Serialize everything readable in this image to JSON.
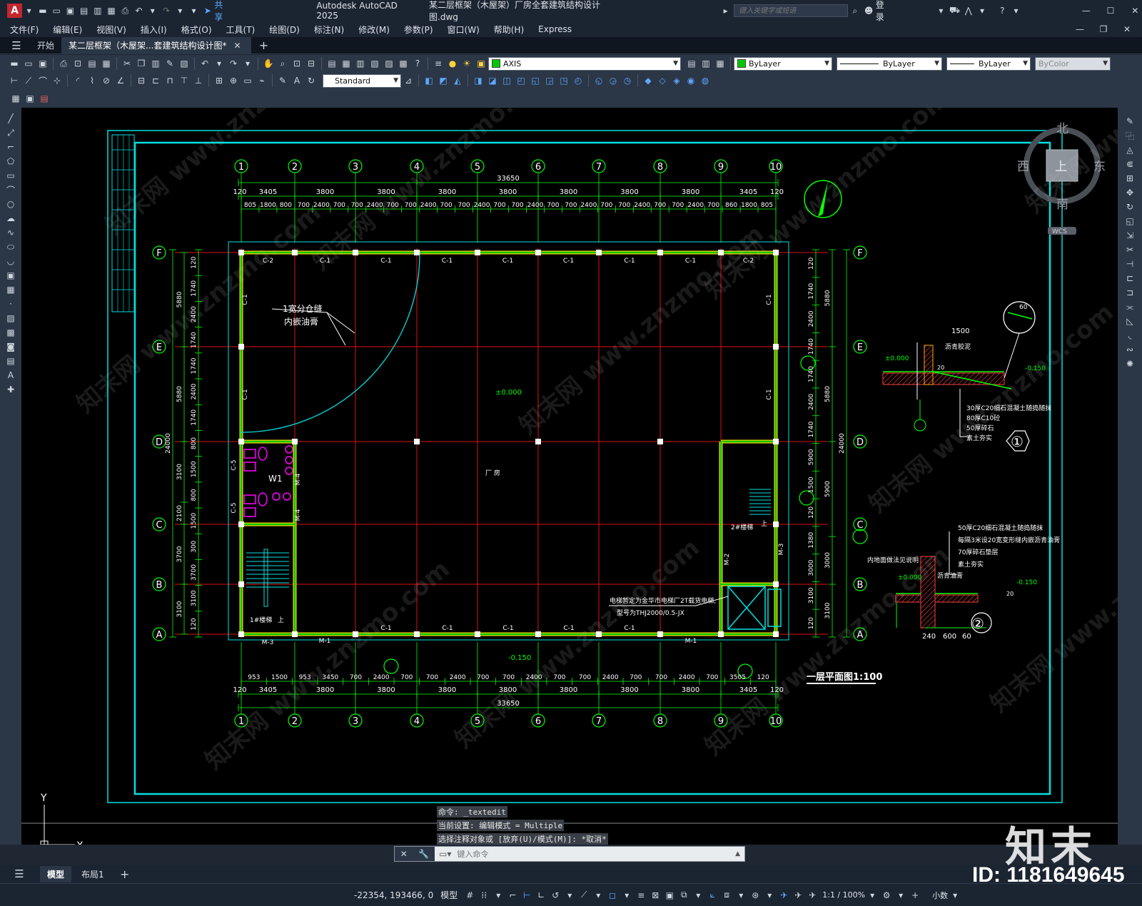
{
  "titlebar": {
    "app_title": "Autodesk AutoCAD 2025",
    "file_title": "某二层框架（木屋架）厂房全套建筑结构设计图.dwg",
    "share_label": "共享",
    "search_placeholder": "键入关键字或短语",
    "login_label": "登录"
  },
  "menu": [
    "文件(F)",
    "编辑(E)",
    "视图(V)",
    "插入(I)",
    "格式(O)",
    "工具(T)",
    "绘图(D)",
    "标注(N)",
    "修改(M)",
    "参数(P)",
    "窗口(W)",
    "帮助(H)",
    "Express"
  ],
  "tabs": {
    "start": "开始",
    "drawing": "某二层框架（木屋架...套建筑结构设计图*"
  },
  "toolbar": {
    "layer_value": "AXIS",
    "layer_color": "#00c800",
    "color_value": "ByLayer",
    "linetype_value": "ByLayer",
    "lineweight_value": "ByLayer",
    "plotstyle_value": "ByColor",
    "textstyle_value": "Standard"
  },
  "viewcube": {
    "north": "北",
    "south": "南",
    "east": "东",
    "west": "西",
    "top": "上",
    "wcs": "WCS"
  },
  "ucs": {
    "x": "X",
    "y": "Y"
  },
  "drawing": {
    "axes_numbers": [
      "1",
      "2",
      "3",
      "4",
      "5",
      "6",
      "7",
      "8",
      "9",
      "10"
    ],
    "axes_letters": [
      "F",
      "E",
      "D",
      "C",
      "B",
      "A"
    ],
    "total_width": "33650",
    "total_depth": "24000",
    "top_dims_1": [
      "120",
      "3405",
      "3800",
      "3800",
      "3800",
      "3800",
      "3800",
      "3800",
      "3800",
      "3405",
      "120"
    ],
    "top_dims_2": [
      "805",
      "1800",
      "800",
      "700",
      "2400",
      "700",
      "700",
      "2400",
      "700",
      "700",
      "2400",
      "700",
      "700",
      "2400",
      "700",
      "700",
      "2400",
      "700",
      "700",
      "2400",
      "700",
      "700",
      "2400",
      "700",
      "700",
      "2400",
      "700",
      "860",
      "1800",
      "805"
    ],
    "bottom_dims_1": [
      "953",
      "1500",
      "953",
      "3450",
      "700",
      "2400",
      "700",
      "700",
      "2400",
      "700",
      "700",
      "2400",
      "700",
      "700",
      "2400",
      "700",
      "700",
      "2400",
      "700",
      "3505",
      "120"
    ],
    "bottom_dims_2": [
      "120",
      "3405",
      "3800",
      "3800",
      "3800",
      "3800",
      "3800",
      "3800",
      "3800",
      "3405",
      "120"
    ],
    "left_dims": [
      "120",
      "1740",
      "2400",
      "1740",
      "1740",
      "2400",
      "1740",
      "800",
      "1500",
      "800",
      "1500",
      "300",
      "3700",
      "3100",
      "120"
    ],
    "left_big": [
      "5880",
      "5880",
      "3100",
      "2100",
      "3700",
      "3100"
    ],
    "right_dims": [
      "120",
      "1740",
      "2400",
      "1740",
      "1740",
      "2400",
      "1740",
      "5900",
      "1500",
      "120",
      "1380",
      "3000",
      "3100",
      "120"
    ],
    "window_labels": [
      "C-2",
      "C-1",
      "C-1",
      "C-1",
      "C-1",
      "C-1",
      "C-1",
      "C-1",
      "C-2"
    ],
    "bottom_windows": [
      "C-1",
      "C-1",
      "C-1",
      "C-1",
      "C-1"
    ],
    "door_labels": [
      "M-3",
      "M-1",
      "M-1",
      "M-4",
      "M-4",
      "M-2",
      "M-3"
    ],
    "side_windows": [
      "C-1",
      "C-1",
      "C-5",
      "C-5"
    ],
    "joint_note_1": "1宽分仓缝",
    "joint_note_2": "内嵌油膏",
    "elevation_0": "±0.000",
    "elevation_neg": "-0.150",
    "room_label": "厂  房",
    "stair1_label": "1#楼梯",
    "stair2_label": "2#楼梯",
    "up_label": "上",
    "wc_label": "W1",
    "elevator_note_1": "电梯暂定为金华市电梯厂2T载货电梯,",
    "elevator_note_2": "型号为THJ2000/0.5-JX",
    "plan_title": "一层平面图1:100",
    "detail1": {
      "dim_1500": "1500",
      "dim_60": "60",
      "dim_20": "20",
      "label_top": "沥青胶泥",
      "layers": [
        "30厚C20细石混凝土随捣随抹",
        "80厚C10砼",
        "50厚碎石",
        "素土夯实"
      ],
      "number": "①"
    },
    "detail2": {
      "layers": [
        "50厚C20细石混凝土随捣随抹",
        "每隔3米设20宽变形缝内嵌沥青油膏",
        "70厚碎石垫层",
        "素土夯实"
      ],
      "label_left": "内地面做法见说明",
      "label_top": "沥青油膏",
      "dims": [
        "240",
        "600",
        "60"
      ],
      "number": "②",
      "dim_20": "20"
    }
  },
  "command": {
    "history": [
      "命令: _textedit",
      "当前设置: 编辑模式 = Multiple",
      "选择注释对象或 [放弃(U)/模式(M)]: *取消*"
    ],
    "placeholder": "键入命令"
  },
  "layout_tabs": [
    "模型",
    "布局1"
  ],
  "status": {
    "coords": "-22354, 193466, 0",
    "model_label": "模型",
    "scale_label": "1:1 / 100%",
    "units_label": "小数"
  },
  "watermark": {
    "brand": "知末",
    "id_text": "ID: 1181649645",
    "site": "www.znzmo.com",
    "site_cn": "知末网"
  }
}
